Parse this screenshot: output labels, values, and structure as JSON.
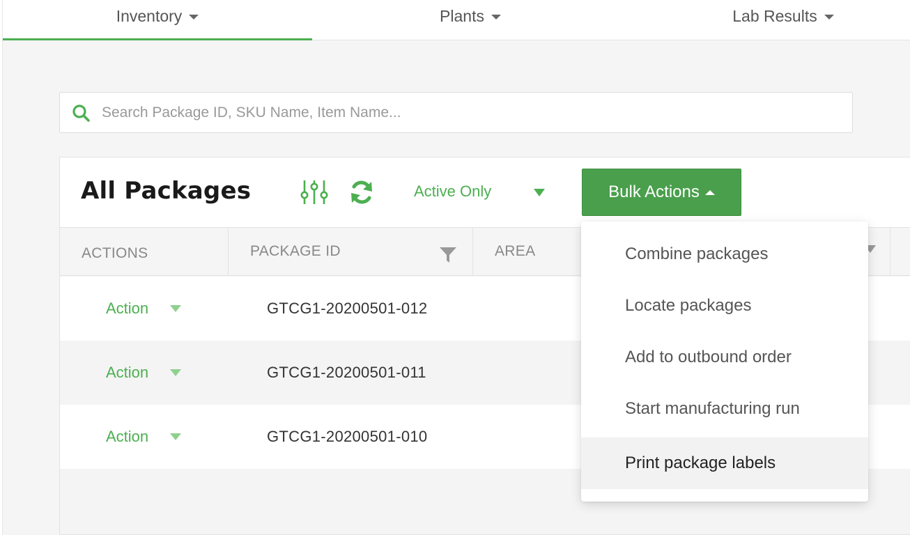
{
  "nav": {
    "items": [
      {
        "label": "Inventory",
        "active": true
      },
      {
        "label": "Plants",
        "active": false
      },
      {
        "label": "Lab Results",
        "active": false
      }
    ]
  },
  "search": {
    "placeholder": "Search Package ID, SKU Name, Item Name...",
    "value": "",
    "icon": "search-icon"
  },
  "panel": {
    "title": "All Packages",
    "icons": [
      "sliders-icon",
      "refresh-icon"
    ],
    "status_filter": "Active Only",
    "bulk_button": "Bulk Actions"
  },
  "table": {
    "columns": [
      "ACTIONS",
      "PACKAGE ID",
      "AREA"
    ],
    "rows": [
      {
        "action": "Action",
        "package_id": "GTCG1-20200501-012"
      },
      {
        "action": "Action",
        "package_id": "GTCG1-20200501-011"
      },
      {
        "action": "Action",
        "package_id": "GTCG1-20200501-010"
      }
    ]
  },
  "bulk_menu": {
    "items": [
      "Combine packages",
      "Locate packages",
      "Add to outbound order",
      "Start manufacturing run",
      "Print package labels"
    ],
    "highlighted": "Print package labels"
  },
  "colors": {
    "accent": "#4caf50",
    "button": "#4a9f4c",
    "header_text": "#888888"
  }
}
